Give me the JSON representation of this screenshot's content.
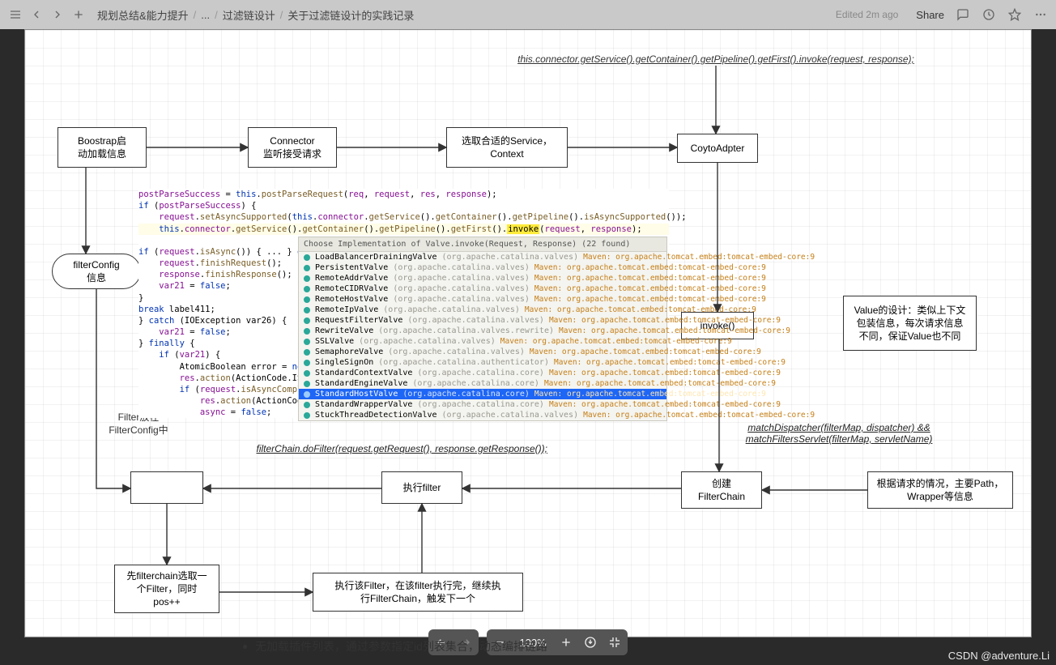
{
  "topbar": {
    "breadcrumbs": [
      "规划总结&能力提升",
      "...",
      "过滤链设计",
      "关于过滤链设计的实践记录"
    ],
    "edited": "Edited 2m ago",
    "share": "Share"
  },
  "diagram": {
    "nodes": {
      "bootstrap": {
        "text": "Boostrap启\n动加载信息"
      },
      "connector": {
        "text": "Connector\n监听接受请求"
      },
      "selectSvc": {
        "text": "选取合适的Service，\nContext"
      },
      "coyote": {
        "text": "CoytoAdpter"
      },
      "filterConfig": {
        "text": "filterConfig\n信息"
      },
      "invoke": {
        "text": "invoke()"
      },
      "valueDesign": {
        "text": "Value的设计：类似上下文\n包装信息，每次请求信息\n不同，保证Value也不同"
      },
      "empty": {
        "text": ""
      },
      "execFilter": {
        "text": "执行filter"
      },
      "createChain": {
        "text": "创建\nFilterChain"
      },
      "byPath": {
        "text": "根据请求的情况，主要Path，\nWrapper等信息"
      },
      "selectOne": {
        "text": "先filterchain选取一\n个Filter，同时\npos++"
      },
      "runNext": {
        "text": "执行该Filter，在该filter执行完，继续执\n行FilterChain，触发下一个"
      }
    },
    "labels": {
      "topLink": "this.connector.getService().getContainer().getPipeline().getFirst().invoke(request, response);",
      "filterNote": "Filter放在\nFilterConfig中",
      "doFilter": "filterChain.doFilter(request.getRequest(), response.getResponse());",
      "matchDisp": "matchDispatcher(filterMap, dispatcher) && matchFiltersServlet(filterMap, servletName)"
    }
  },
  "code": {
    "pre_lines": [
      "postParseSuccess = this.postParseRequest(req, request, res, response);",
      "if (postParseSuccess) {",
      "    request.setAsyncSupported(this.connector.getService().getContainer().getPipeline().isAsyncSupported());",
      "    this.connector.getService().getContainer().getPipeline().getFirst().invoke(request, response);",
      "",
      "if (request.isAsync()) { ... } else {",
      "    request.finishRequest();",
      "    response.finishResponse();",
      "    var21 = false;",
      "}",
      "break label411;",
      "} catch (IOException var26) {",
      "    var21 = false;",
      "} finally {",
      "    if (var21) {",
      "        AtomicBoolean error = new Atomic",
      "        res.action(ActionCode.IS_ERROR,",
      "        if (request.isAsyncCompleting()",
      "            res.action(ActionCode.ASYNC_",
      "            async = false;"
    ],
    "highlight_token": "invoke",
    "popup_title": "Choose Implementation of Valve.invoke(Request, Response) (22 found)",
    "popup_rows": [
      {
        "name": "LoadBalancerDrainingValve",
        "pkg": "(org.apache.catalina.valves)",
        "src": "Maven: org.apache.tomcat.embed:tomcat-embed-core:9",
        "sel": false
      },
      {
        "name": "PersistentValve",
        "pkg": "(org.apache.catalina.valves)",
        "src": "Maven: org.apache.tomcat.embed:tomcat-embed-core:9",
        "sel": false
      },
      {
        "name": "RemoteAddrValve",
        "pkg": "(org.apache.catalina.valves)",
        "src": "Maven: org.apache.tomcat.embed:tomcat-embed-core:9",
        "sel": false
      },
      {
        "name": "RemoteCIDRValve",
        "pkg": "(org.apache.catalina.valves)",
        "src": "Maven: org.apache.tomcat.embed:tomcat-embed-core:9",
        "sel": false
      },
      {
        "name": "RemoteHostValve",
        "pkg": "(org.apache.catalina.valves)",
        "src": "Maven: org.apache.tomcat.embed:tomcat-embed-core:9",
        "sel": false
      },
      {
        "name": "RemoteIpValve",
        "pkg": "(org.apache.catalina.valves)",
        "src": "Maven: org.apache.tomcat.embed:tomcat-embed-core:9",
        "sel": false
      },
      {
        "name": "RequestFilterValve",
        "pkg": "(org.apache.catalina.valves)",
        "src": "Maven: org.apache.tomcat.embed:tomcat-embed-core:9",
        "sel": false
      },
      {
        "name": "RewriteValve",
        "pkg": "(org.apache.catalina.valves.rewrite)",
        "src": "Maven: org.apache.tomcat.embed:tomcat-embed-core:9",
        "sel": false
      },
      {
        "name": "SSLValve",
        "pkg": "(org.apache.catalina.valves)",
        "src": "Maven: org.apache.tomcat.embed:tomcat-embed-core:9",
        "sel": false
      },
      {
        "name": "SemaphoreValve",
        "pkg": "(org.apache.catalina.valves)",
        "src": "Maven: org.apache.tomcat.embed:tomcat-embed-core:9",
        "sel": false
      },
      {
        "name": "SingleSignOn",
        "pkg": "(org.apache.catalina.authenticator)",
        "src": "Maven: org.apache.tomcat.embed:tomcat-embed-core:9",
        "sel": false
      },
      {
        "name": "StandardContextValve",
        "pkg": "(org.apache.catalina.core)",
        "src": "Maven: org.apache.tomcat.embed:tomcat-embed-core:9",
        "sel": false
      },
      {
        "name": "StandardEngineValve",
        "pkg": "(org.apache.catalina.core)",
        "src": "Maven: org.apache.tomcat.embed:tomcat-embed-core:9",
        "sel": false
      },
      {
        "name": "StandardHostValve",
        "pkg": "(org.apache.catalina.core)",
        "src": "Maven: org.apache.tomcat.embed:tomcat-embed-core:9",
        "sel": true
      },
      {
        "name": "StandardWrapperValve",
        "pkg": "(org.apache.catalina.core)",
        "src": "Maven: org.apache.tomcat.embed:tomcat-embed-core:9",
        "sel": false
      },
      {
        "name": "StuckThreadDetectionValve",
        "pkg": "(org.apache.catalina.valves)",
        "src": "Maven: org.apache.tomcat.embed:tomcat-embed-core:9",
        "sel": false
      }
    ]
  },
  "toolbar": {
    "zoom": "100%"
  },
  "belowText": "无加载插件列表，通过参数指定id列表集合，动态编排链路",
  "watermark": "CSDN @adventure.Li"
}
